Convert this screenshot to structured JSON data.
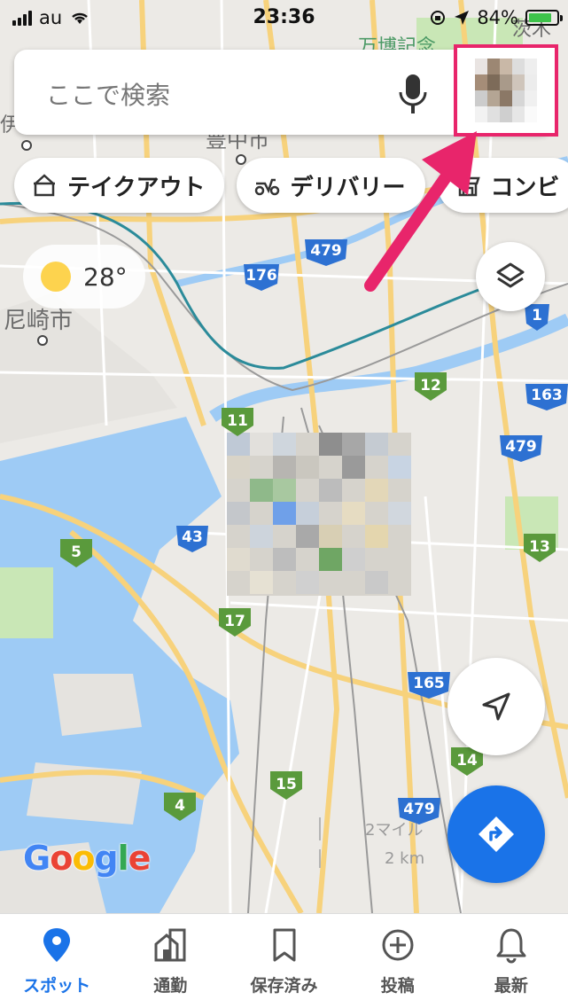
{
  "status": {
    "carrier": "au",
    "time": "23:36",
    "battery": "84%",
    "battery_level": 0.84
  },
  "search": {
    "placeholder": "ここで検索"
  },
  "chips": [
    {
      "label": "テイクアウト",
      "icon": "takeout-icon"
    },
    {
      "label": "デリバリー",
      "icon": "delivery-scooter-icon"
    },
    {
      "label": "コンビ",
      "icon": "convenience-store-icon"
    }
  ],
  "weather": {
    "temp": "28°"
  },
  "map": {
    "labels": [
      "豊中市",
      "尼崎市",
      "伊丹",
      "万博記念",
      "茨木"
    ],
    "route_shields_yellow": [
      "176",
      "479",
      "43",
      "479",
      "165",
      "479",
      "163",
      "1"
    ],
    "route_shields_green": [
      "12",
      "11",
      "5",
      "17",
      "13",
      "15",
      "4",
      "14"
    ],
    "scale": {
      "miles": "2マイル",
      "km": "2 km"
    },
    "logo": "Google"
  },
  "colors": {
    "accent": "#1a73e8",
    "highlight": "#e8256b",
    "water": "#9ecbf5",
    "park": "#c9e7b6"
  },
  "tabs": [
    {
      "label": "スポット",
      "icon": "pin-icon",
      "active": true
    },
    {
      "label": "通勤",
      "icon": "commute-home-icon",
      "active": false
    },
    {
      "label": "保存済み",
      "icon": "bookmark-icon",
      "active": false
    },
    {
      "label": "投稿",
      "icon": "add-circle-icon",
      "active": false
    },
    {
      "label": "最新",
      "icon": "bell-icon",
      "active": false
    }
  ]
}
